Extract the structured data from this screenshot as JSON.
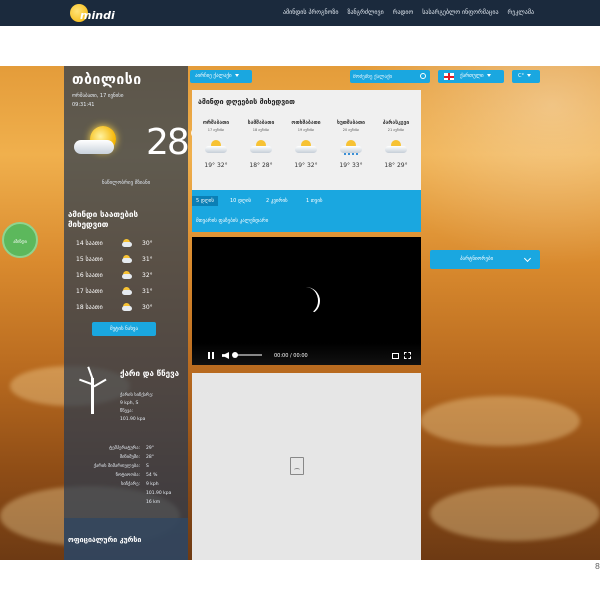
{
  "header": {
    "logo_text": "mindi",
    "nav": [
      "ამინდის პროგნოზი",
      "ზანგრძლივი",
      "რადიო",
      "სასარგებლო ინფორმაცია",
      "რეკლამა"
    ]
  },
  "current": {
    "city": "თბილისი",
    "date": "ორშაბათი, 17 ივნისი",
    "time": "09:31:41",
    "temp": "28°",
    "feels": "ნაწილობრივ მზიანი"
  },
  "hourly": {
    "title": "ამინდი საათების მიხედვით",
    "rows": [
      {
        "hour": "14 საათი",
        "temp": "30°"
      },
      {
        "hour": "15 საათი",
        "temp": "31°"
      },
      {
        "hour": "16 საათი",
        "temp": "32°"
      },
      {
        "hour": "17 საათი",
        "temp": "31°"
      },
      {
        "hour": "18 საათი",
        "temp": "30°"
      }
    ],
    "more_label": "მეტის ნახვა"
  },
  "wind": {
    "title": "ქარი და წნევა",
    "label1": "ქარის სიჩქარე:",
    "speed": "9 kph, S",
    "label2": "წნევა:",
    "pressure": "101.90 kpa"
  },
  "details": [
    {
      "k": "ტემპერატურა:",
      "v": "29°"
    },
    {
      "k": "მინიმუმი:",
      "v": "28°"
    },
    {
      "k": "ქარის მიმართულება:",
      "v": "S"
    },
    {
      "k": "ნოტიოობა:",
      "v": "54 %"
    },
    {
      "k": "სიჩქარე:",
      "v": "9 kph"
    },
    {
      "k": "",
      "v": "101.90 kpa"
    },
    {
      "k": "",
      "v": "16 km"
    }
  ],
  "official_rate": "ოფიციალური კურსი",
  "badge_text": "ამინდი",
  "controls": {
    "city_select": "აირჩიე ქალაქი",
    "search_placeholder": "მოძებნე ქალაქი",
    "language": "ქართული",
    "unit": "C°"
  },
  "forecast": {
    "title": "ამინდი დღეების მიხედვით",
    "days": [
      {
        "name": "ორშაბათი",
        "date": "17 ივნისი",
        "temps": "19°  32°"
      },
      {
        "name": "სამშაბათი",
        "date": "18 ივნისი",
        "temps": "18°  28°"
      },
      {
        "name": "ოთხშაბათი",
        "date": "19 ივნისი",
        "temps": "19°  32°"
      },
      {
        "name": "ხუთშაბათი",
        "date": "20 ივნისი",
        "temps": "19°  33°"
      },
      {
        "name": "პარასკევი",
        "date": "21 ივნისი",
        "temps": "18°  29°"
      }
    ]
  },
  "tabs": {
    "items": [
      "5 დღის",
      "10 დღის",
      "2 კვირის",
      "1 თვის"
    ],
    "calendar": "მთვარის ფაზების კალენდარი"
  },
  "video": {
    "time": "00:00 / 00:00"
  },
  "partners_label": "პარტნიორები",
  "page_number": "8"
}
